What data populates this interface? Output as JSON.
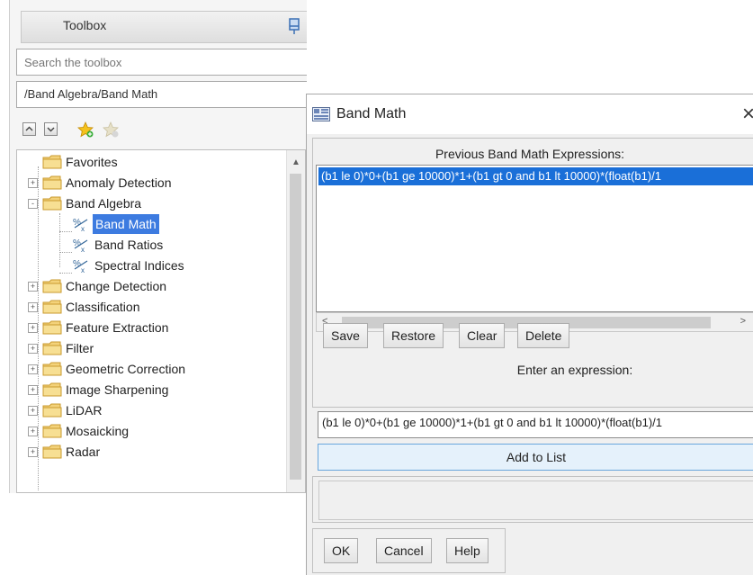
{
  "toolbox": {
    "title": "Toolbox",
    "search_placeholder": "Search the toolbox",
    "path": "/Band Algebra/Band Math",
    "tree": [
      {
        "label": "Favorites",
        "kind": "folder",
        "expander": ""
      },
      {
        "label": "Anomaly Detection",
        "kind": "folder",
        "expander": "+"
      },
      {
        "label": "Band Algebra",
        "kind": "folder",
        "expander": "-"
      },
      {
        "label": "Band Math",
        "kind": "tool",
        "selected": true
      },
      {
        "label": "Band Ratios",
        "kind": "tool"
      },
      {
        "label": "Spectral Indices",
        "kind": "tool"
      },
      {
        "label": "Change Detection",
        "kind": "folder",
        "expander": "+"
      },
      {
        "label": "Classification",
        "kind": "folder",
        "expander": "+"
      },
      {
        "label": "Feature Extraction",
        "kind": "folder",
        "expander": "+"
      },
      {
        "label": "Filter",
        "kind": "folder",
        "expander": "+"
      },
      {
        "label": "Geometric Correction",
        "kind": "folder",
        "expander": "+"
      },
      {
        "label": "Image Sharpening",
        "kind": "folder",
        "expander": "+"
      },
      {
        "label": "LiDAR",
        "kind": "folder",
        "expander": "+"
      },
      {
        "label": "Mosaicking",
        "kind": "folder",
        "expander": "+"
      },
      {
        "label": "Radar",
        "kind": "folder",
        "expander": "+"
      }
    ],
    "icons": {
      "pin": "pin-icon",
      "collapse": "collapse-all-icon",
      "expand": "expand-all-icon",
      "add_favorite": "add-favorite-star-icon",
      "remove_favorite": "remove-favorite-star-icon",
      "folder": "folder-icon",
      "tool": "band-math-tool-icon"
    }
  },
  "dialog": {
    "title": "Band Math",
    "close_glyph": "×",
    "previous_caption": "Previous Band Math Expressions:",
    "previous_expressions": [
      "(b1 le 0)*0+(b1 ge 10000)*1+(b1 gt 0 and b1 lt 10000)*(float(b1)/1"
    ],
    "buttons": {
      "save": "Save",
      "restore": "Restore",
      "clear": "Clear",
      "delete": "Delete"
    },
    "enter_caption": "Enter an expression:",
    "expression_value": "(b1 le 0)*0+(b1 ge 10000)*1+(b1 gt 0 and b1 lt 10000)*(float(b1)/1",
    "add_to_list": "Add to List",
    "footer": {
      "ok": "OK",
      "cancel": "Cancel",
      "help": "Help"
    },
    "colors": {
      "selection": "#1a6fd8",
      "add_button_bg": "#e5f1fb"
    }
  }
}
